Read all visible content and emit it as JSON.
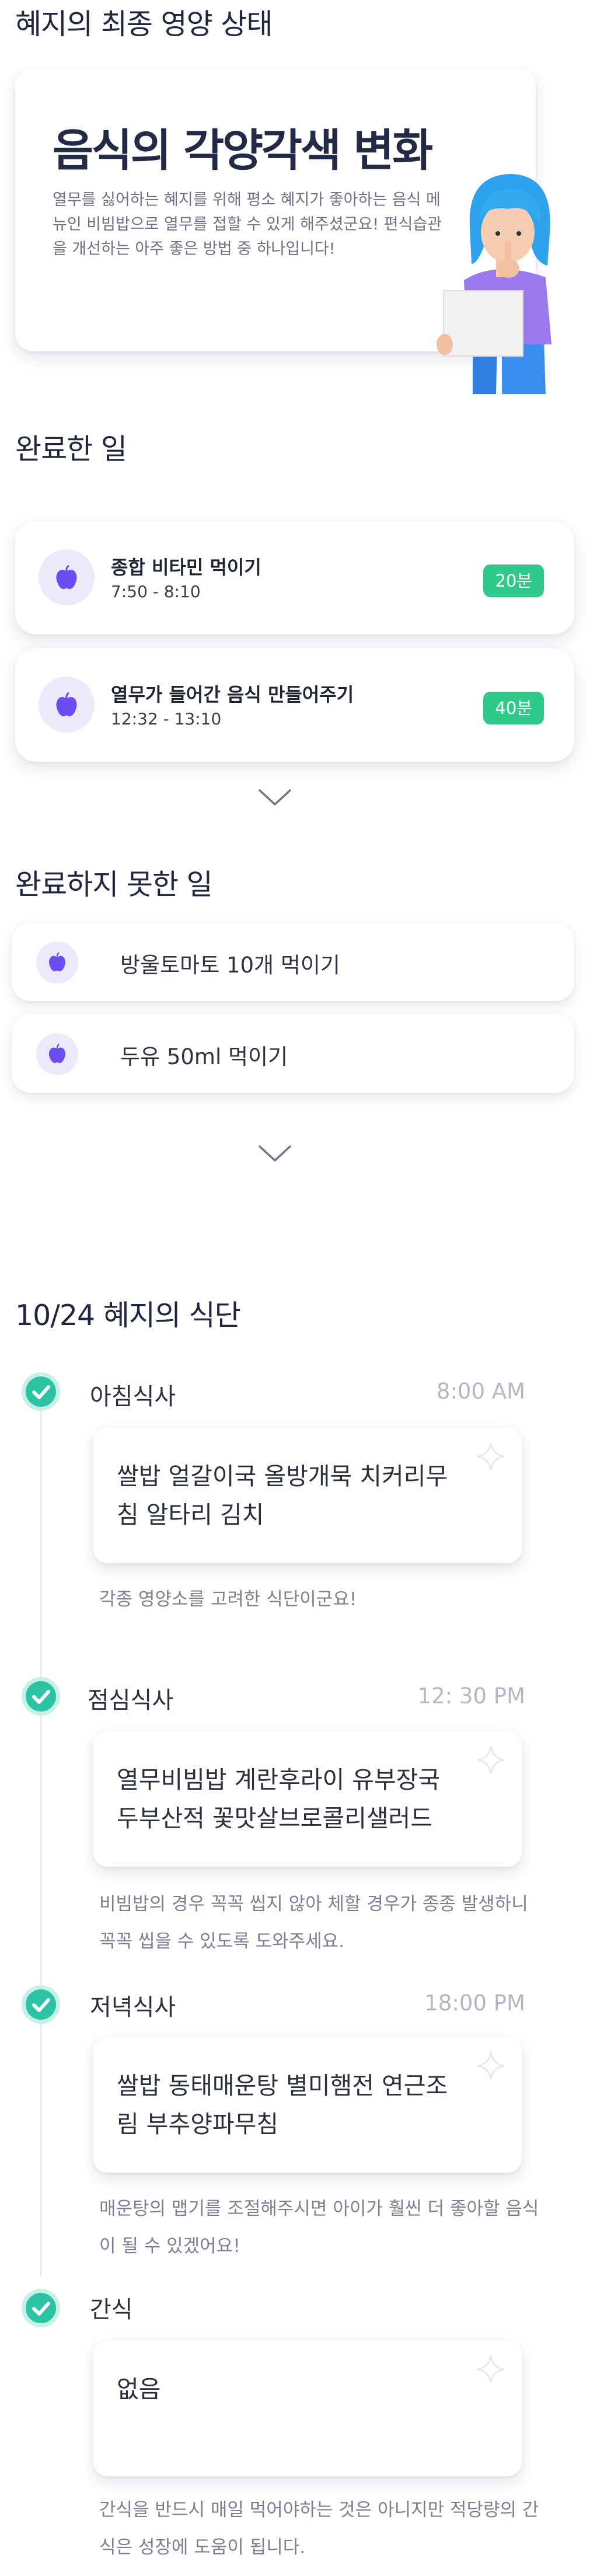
{
  "sections": {
    "nutrition_title": "혜지의 최종 영양 상태",
    "done_title": "완료한 일",
    "undone_title": "완료하지 못한 일",
    "diet_title": "10/24 혜지의 식단"
  },
  "feature": {
    "headline": "음식의 각양각색 변화",
    "body": "열무를 싫어하는 혜지를 위해 평소 혜지가 좋아하는 음식 메뉴인 비빔밥으로 열무를 접할 수 있게 해주셨군요! 편식습관을 개선하는 아주 좋은 방법 중 하나입니다!"
  },
  "done_tasks": [
    {
      "title": "종합 비타민 먹이기",
      "time": "7:50 - 8:10",
      "badge": "20분",
      "icon": "apple-icon"
    },
    {
      "title": "열무가 들어간 음식 만들어주기",
      "time": "12:32 - 13:10",
      "badge": "40분",
      "icon": "apple-icon"
    }
  ],
  "undone_tasks": [
    {
      "label": "방울토마토 10개 먹이기",
      "icon": "apple-icon"
    },
    {
      "label": "두유 50ml 먹이기",
      "icon": "apple-icon"
    }
  ],
  "meals": [
    {
      "name": "아침식사",
      "time": "8:00 AM",
      "menu": "쌀밥 얼갈이국 올방개묵 치커리무침 알타리 김치",
      "note": "각종 영양소를 고려한 식단이군요!"
    },
    {
      "name": "점심식사",
      "time": "12: 30 PM",
      "menu": "열무비빔밥 계란후라이 유부장국 두부산적 꽃맛살브로콜리샐러드",
      "note": "비빔밥의 경우 꼭꼭 씹지 않아 체할 경우가 종종 발생하니 꼭꼭 씹을 수 있도록 도와주세요."
    },
    {
      "name": "저녁식사",
      "time": "18:00 PM",
      "menu": "쌀밥 동태매운탕 별미햄전 연근조림 부추양파무침",
      "note": "매운탕의 맵기를 조절해주시면 아이가 훨씬 더 좋아할 음식이 될 수 있겠어요!"
    },
    {
      "name": "간식",
      "time": "",
      "menu": "없음",
      "note": "간식을 반드시 매일 먹어야하는 것은 아니지만 적당량의 간식은 성장에 도움이 됩니다."
    }
  ],
  "colors": {
    "accent_purple": "#6a4cf0",
    "badge_green": "#2fc989",
    "check_teal": "#2cc3a5"
  }
}
